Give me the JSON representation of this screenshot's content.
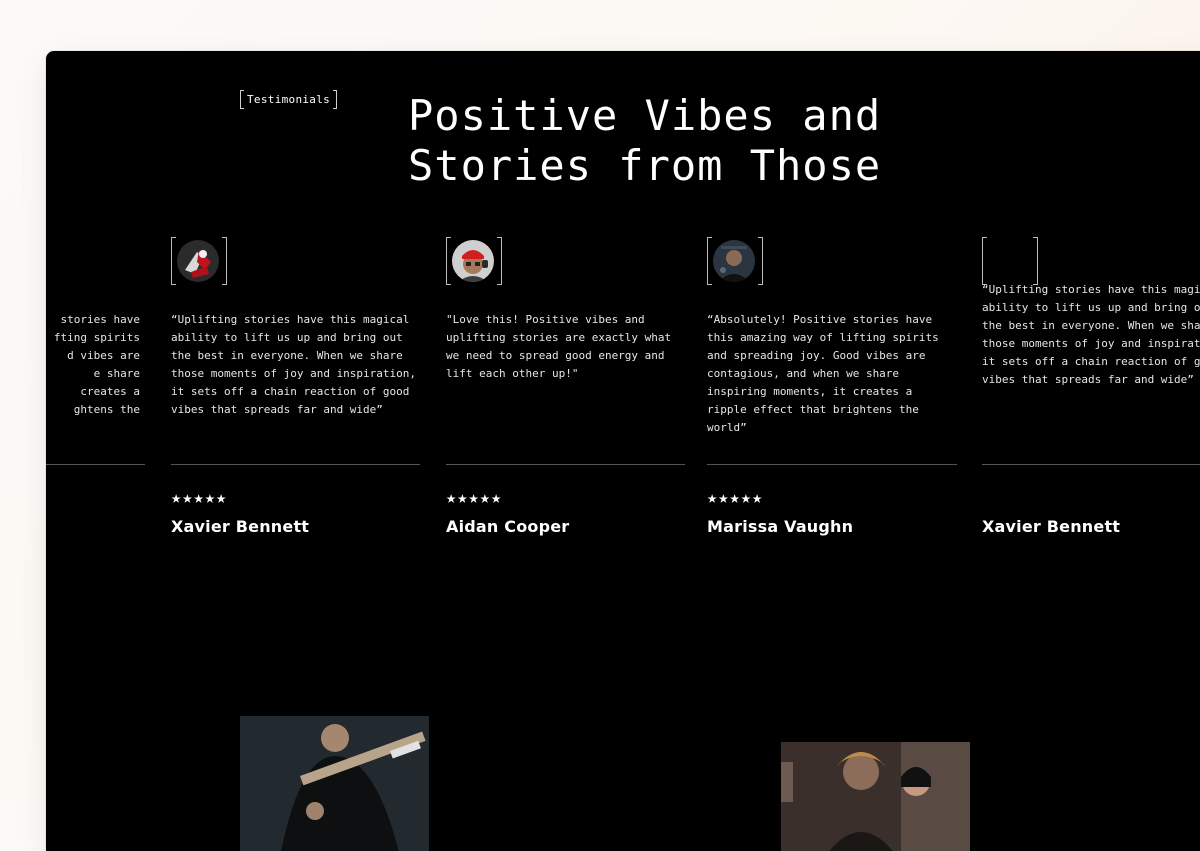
{
  "section": {
    "tag": "Testimonials",
    "title": "Positive Vibes and\nStories from Those"
  },
  "partial_left_quote": "stories have\nfting spirits\nd vibes are\ne share\ncreates a\nghtens the",
  "testimonials": [
    {
      "quote": "“Uplifting stories have this magical ability to lift us up and bring out the best in everyone. When we share those moments of joy and inspiration, it sets off a chain reaction of good vibes that spreads far and wide”",
      "stars": "★★★★★",
      "name": "Xavier Bennett",
      "avatar_icon": "avatar-guitar-red"
    },
    {
      "quote": "\"Love this! Positive vibes and uplifting stories are exactly what we need to spread good energy and lift each other up!\"",
      "stars": "★★★★★",
      "name": "Aidan Cooper",
      "avatar_icon": "avatar-red-cap"
    },
    {
      "quote": "“Absolutely! Positive stories have this amazing way of lifting spirits and spreading joy. Good vibes are contagious, and when we share inspiring moments, it creates a ripple effect that brightens the world”",
      "stars": "★★★★★",
      "name": "Marissa Vaughn",
      "avatar_icon": "avatar-dark-portrait"
    },
    {
      "quote": "“Uplifting stories have this magical ability to lift us up and bring out the best in everyone. When we share those moments of joy and inspiration, it sets off a chain reaction of good vibes that spreads far and wide”",
      "stars": "",
      "name": "Xavier Bennett",
      "avatar_icon": "avatar-empty"
    }
  ],
  "colors": {
    "background": "#000000",
    "text": "#ffffff",
    "divider": "#555555"
  }
}
